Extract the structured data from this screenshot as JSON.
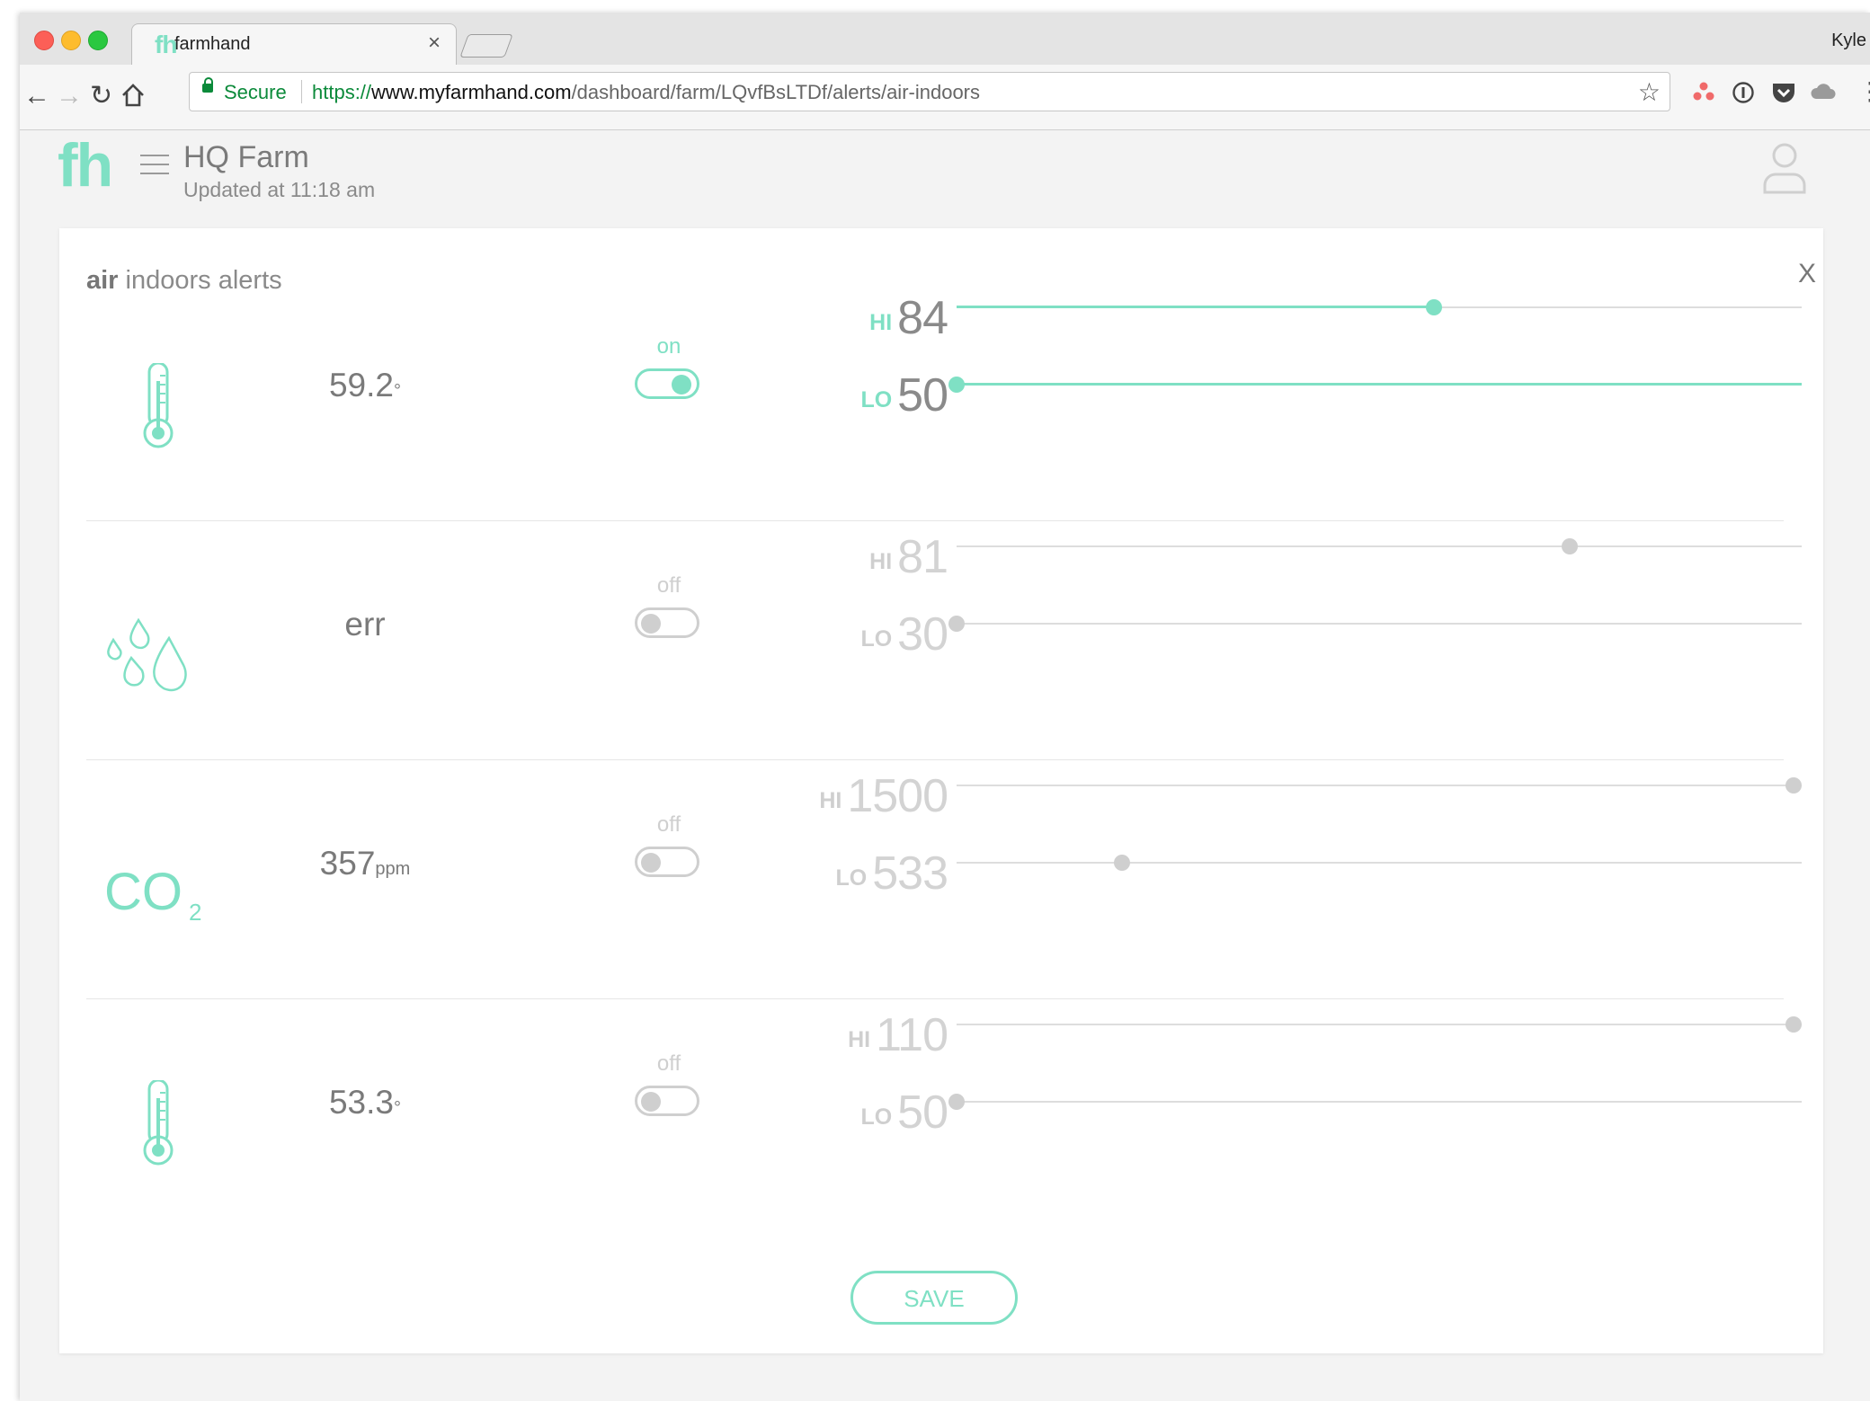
{
  "browser": {
    "tab_title": "farmhand",
    "tab_favicon": "fh",
    "tab_close": "×",
    "profile_name": "Kyle",
    "secure_label": "Secure",
    "url_scheme": "https://",
    "url_host": "www.myfarmhand.com",
    "url_path": "/dashboard/farm/LQvfBsLTDf/alerts/air-indoors"
  },
  "header": {
    "logo": "fh",
    "farm_name": "HQ Farm",
    "updated": "Updated at 11:18 am"
  },
  "card": {
    "title_bold": "air",
    "title_rest": " indoors alerts",
    "close": "X",
    "save_label": "SAVE"
  },
  "colors": {
    "accent": "#7fe0c4",
    "inactive": "#cfcfcf",
    "text": "#7a7a7a"
  },
  "rows": [
    {
      "icon": "thermometer-icon",
      "reading": "59.2",
      "unit": "°",
      "toggle": "on",
      "enabled": true,
      "hi_tag": "HI",
      "hi": "84",
      "hi_fraction": 0.565,
      "lo_tag": "LO",
      "lo": "50",
      "lo_fraction": 0.0
    },
    {
      "icon": "water-drops-icon",
      "reading": "err",
      "unit": "",
      "toggle": "off",
      "enabled": false,
      "hi_tag": "HI",
      "hi": "81",
      "hi_fraction": 0.725,
      "lo_tag": "LO",
      "lo": "30",
      "lo_fraction": 0.0
    },
    {
      "icon": "co2-icon",
      "reading": "357",
      "unit": "ppm",
      "toggle": "off",
      "enabled": false,
      "hi_tag": "HI",
      "hi": "1500",
      "hi_fraction": 0.99,
      "lo_tag": "LO",
      "lo": "533",
      "lo_fraction": 0.196
    },
    {
      "icon": "thermometer-icon",
      "reading": "53.3",
      "unit": "°",
      "toggle": "off",
      "enabled": false,
      "hi_tag": "HI",
      "hi": "110",
      "hi_fraction": 0.99,
      "lo_tag": "LO",
      "lo": "50",
      "lo_fraction": 0.0
    }
  ]
}
